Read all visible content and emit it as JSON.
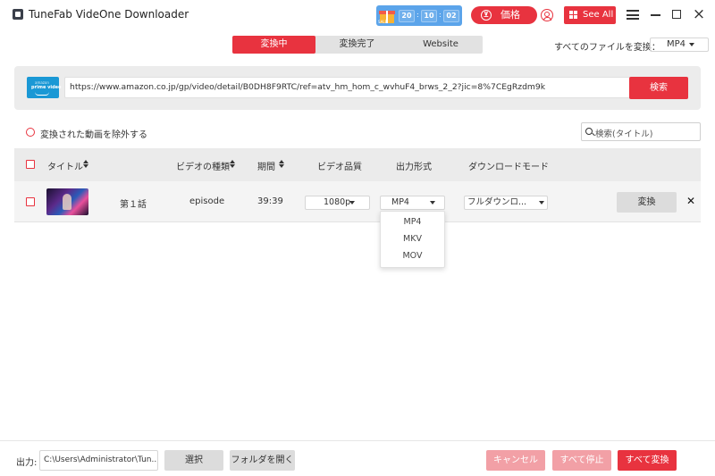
{
  "app": {
    "title": "TuneFab VideOne Downloader"
  },
  "promo": {
    "tag": "SALE",
    "days": "20",
    "hours": "10",
    "minutes": "02",
    "sep": ":"
  },
  "header": {
    "price_label": "価格",
    "price_icon_glyph": "⊻",
    "see_all_label": "See All"
  },
  "tabs": [
    {
      "label": "変換中",
      "active": true
    },
    {
      "label": "変換完了",
      "active": false
    },
    {
      "label": "Website",
      "active": false
    }
  ],
  "convert_all": {
    "label": "すべてのファイルを変換：",
    "value": "MP4"
  },
  "source": {
    "logo_top": "amazon",
    "logo_text": "prime video",
    "url": "https://www.amazon.co.jp/gp/video/detail/B0DH8F9RTC/ref=atv_hm_hom_c_wvhuF4_brws_2_2?jic=8%7CEgRzdm9k",
    "search_label": "検索"
  },
  "filter": {
    "exclude_label": "変換された動画を除外する",
    "search_placeholder": "検索(タイトル)"
  },
  "table": {
    "headers": {
      "title": "タイトル",
      "type": "ビデオの種類",
      "duration": "期間",
      "quality": "ビデオ品質",
      "format": "出力形式",
      "mode": "ダウンロードモード"
    },
    "rows": [
      {
        "title": "第１話",
        "type": "episode",
        "duration": "39:39",
        "quality": "1080p",
        "format": "MP4",
        "mode": "フルダウンロ...",
        "convert_label": "変換",
        "delete_glyph": "✕"
      }
    ]
  },
  "format_options": [
    "MP4",
    "MKV",
    "MOV"
  ],
  "footer": {
    "output_label": "出力:",
    "output_path": "C:\\Users\\Administrator\\Tun...",
    "select_label": "選択",
    "open_folder_label": "フォルダを開く",
    "cancel_label": "キャンセル",
    "stop_all_label": "すべて停止",
    "convert_all_label": "すべて変換"
  },
  "colors": {
    "accent": "#e8333f",
    "accent_light": "#f2a0a6",
    "promo": "#5ba4ea",
    "prime": "#1a98d5"
  }
}
